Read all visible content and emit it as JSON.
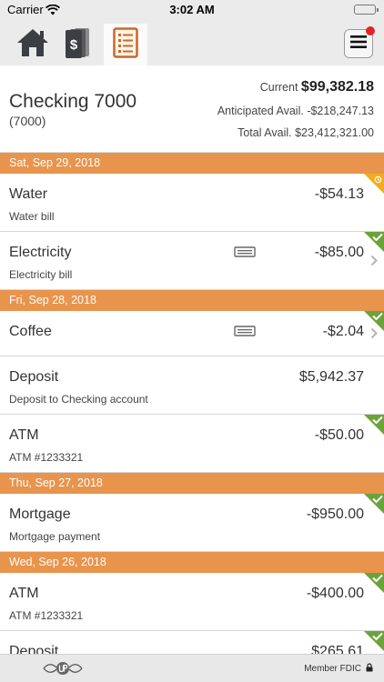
{
  "status_bar": {
    "carrier": "Carrier",
    "time": "3:02 AM"
  },
  "toolbar": {
    "nav": [
      {
        "icon": "home-icon"
      },
      {
        "icon": "dollar-bills-icon"
      },
      {
        "icon": "register-ledger-icon",
        "active": true
      }
    ],
    "menu_icon": "hamburger-menu-icon",
    "notification_color": "#e1242a"
  },
  "account": {
    "name": "Checking 7000",
    "number": "(7000)",
    "current_label": "Current",
    "current_value": "$99,382.18",
    "anticipated_label": "Anticipated Avail.",
    "anticipated_value": "-$218,247.13",
    "total_label": "Total Avail.",
    "total_value": "$23,412,321.00"
  },
  "colors": {
    "accent": "#e8944d",
    "cleared": "#6ba33b",
    "pending": "#f0ad1f"
  },
  "groups": [
    {
      "date": "Sat, Sep 29, 2018",
      "transactions": [
        {
          "payee": "Water",
          "amount": "-$54.13",
          "memo": "Water bill",
          "status": "pending"
        },
        {
          "payee": "Electricity",
          "amount": "-$85.00",
          "memo": "Electricity bill",
          "status": "cleared"
        }
      ]
    },
    {
      "date": "Fri, Sep 28, 2018",
      "transactions": [
        {
          "payee": "Coffee",
          "amount": "-$2.04",
          "memo": "",
          "status": "cleared"
        },
        {
          "payee": "Deposit",
          "amount": "$5,942.37",
          "memo": "Deposit to Checking account",
          "status": "none"
        },
        {
          "payee": "ATM",
          "amount": "-$50.00",
          "memo": "ATM #1233321",
          "status": "cleared"
        }
      ]
    },
    {
      "date": "Thu, Sep 27, 2018",
      "transactions": [
        {
          "payee": "Mortgage",
          "amount": "-$950.00",
          "memo": "Mortgage payment",
          "status": "cleared"
        }
      ]
    },
    {
      "date": "Wed, Sep 26, 2018",
      "transactions": [
        {
          "payee": "ATM",
          "amount": "-$400.00",
          "memo": "ATM #1233321",
          "status": "cleared"
        },
        {
          "payee": "Deposit",
          "amount": "$265.61",
          "memo": "",
          "status": "cleared"
        }
      ]
    }
  ],
  "footer": {
    "logo_icon": "up-logo-icon",
    "member_fdic": "Member FDIC",
    "lock_icon": "lock-icon"
  }
}
